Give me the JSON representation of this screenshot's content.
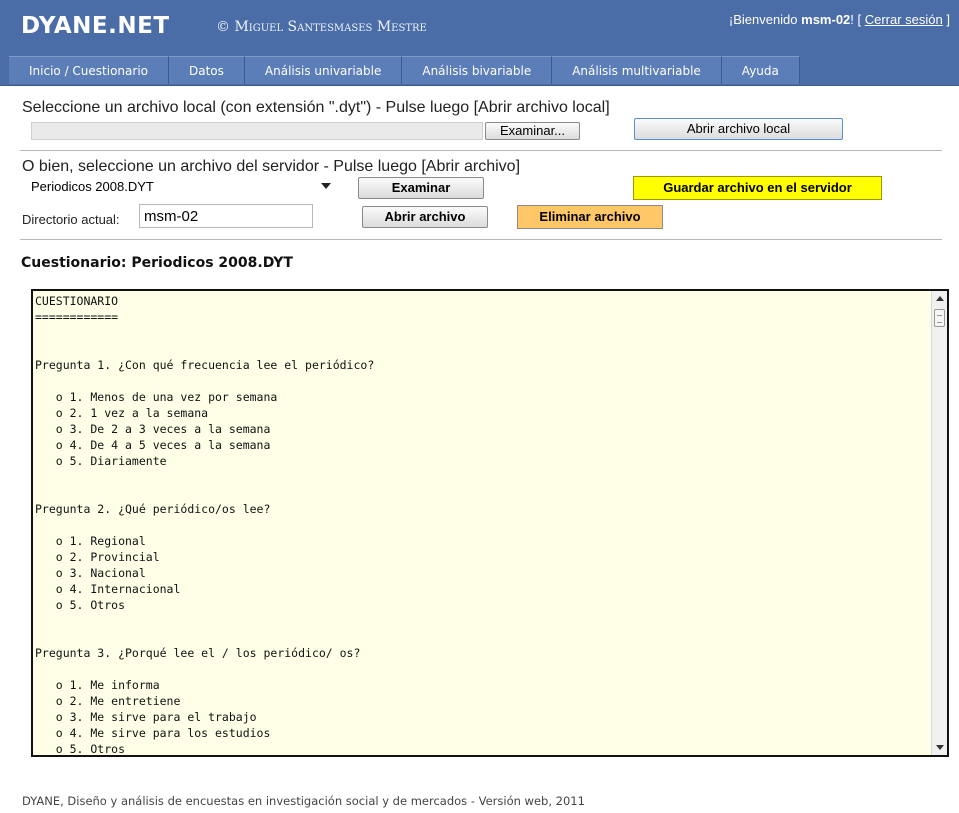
{
  "header": {
    "logo": "DYANE.NET",
    "copyright": "© Miguel Santesmases Mestre",
    "welcome_prefix": "¡Bienvenido ",
    "username": "msm-02",
    "welcome_suffix": "! [ ",
    "logout_label": "Cerrar sesión",
    "logout_close": " ]"
  },
  "nav": {
    "items": [
      {
        "label": "Inicio / Cuestionario"
      },
      {
        "label": "Datos"
      },
      {
        "label": "Análisis univariable"
      },
      {
        "label": "Análisis bivariable"
      },
      {
        "label": "Análisis multivariable"
      },
      {
        "label": "Ayuda"
      }
    ]
  },
  "local_file": {
    "instruction": "Seleccione un archivo local (con extensión \".dyt\") - Pulse luego [Abrir archivo local]",
    "file_value": "",
    "browse_label": "Examinar...",
    "open_label": "Abrir archivo local"
  },
  "server_file": {
    "instruction": "O bien, seleccione un archivo del servidor - Pulse luego [Abrir archivo]",
    "selected": "Periodicos 2008.DYT",
    "browse_label": "Examinar",
    "save_label": "Guardar archivo en el servidor",
    "dir_label": "Directorio actual:",
    "dir_value": "msm-02",
    "open_label": "Abrir archivo",
    "delete_label": "Eliminar archivo"
  },
  "questionnaire": {
    "title": "Cuestionario: Periodicos 2008.DYT",
    "text": "CUESTIONARIO\n============\n\n\nPregunta 1. ¿Con qué frecuencia lee el periódico?\n\n   o 1. Menos de una vez por semana\n   o 2. 1 vez a la semana\n   o 3. De 2 a 3 veces a la semana\n   o 4. De 4 a 5 veces a la semana\n   o 5. Diariamente\n\n\nPregunta 2. ¿Qué periódico/os lee?\n\n   o 1. Regional\n   o 2. Provincial\n   o 3. Nacional\n   o 4. Internacional\n   o 5. Otros\n\n\nPregunta 3. ¿Porqué lee el / los periódico/ os?\n\n   o 1. Me informa\n   o 2. Me entretiene\n   o 3. Me sirve para el trabajo\n   o 4. Me sirve para los estudios\n   o 5. Otros"
  },
  "footer": {
    "text": "DYANE, Diseño y análisis de encuestas en investigación social y de mercados - Versión web, 2011"
  },
  "colors": {
    "header_bg": "#4a6da8",
    "nav_item_bg": "#5b7eb9",
    "save_button": "#ffff00",
    "delete_button": "#ffc766",
    "text_area_bg": "#ffffe8"
  }
}
